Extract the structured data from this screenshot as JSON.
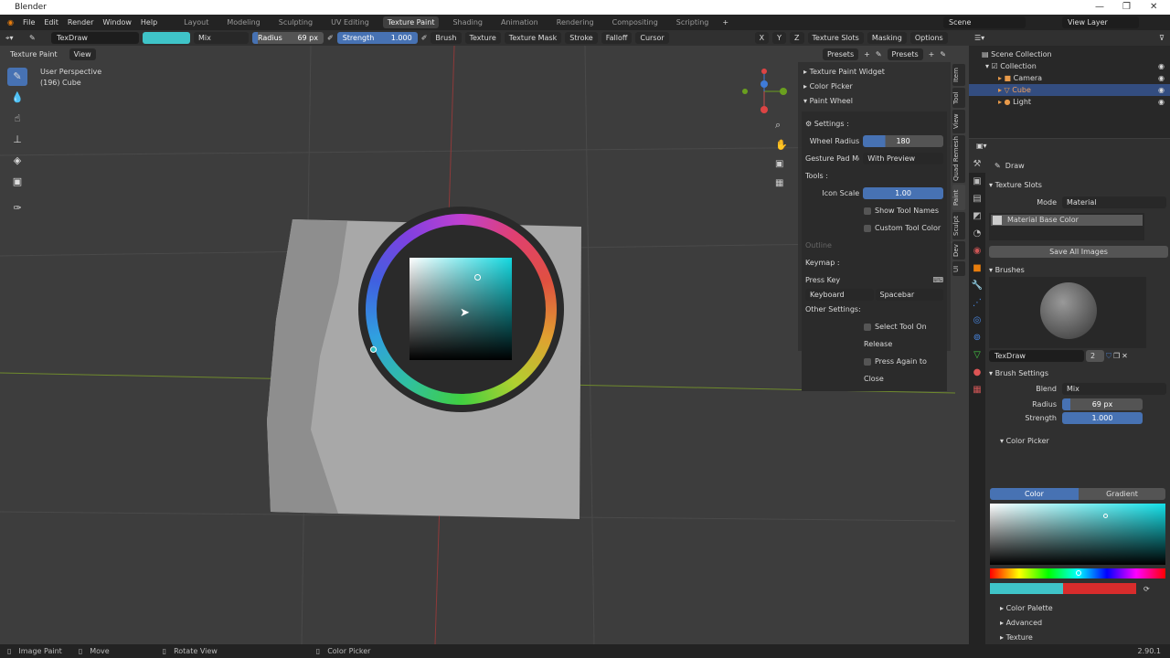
{
  "window": {
    "title": "Blender",
    "minimize": "—",
    "maximize": "❐",
    "close": "✕"
  },
  "menu": {
    "items": [
      "File",
      "Edit",
      "Render",
      "Window",
      "Help"
    ],
    "workspaces": [
      "Layout",
      "Modeling",
      "Sculpting",
      "UV Editing",
      "Texture Paint",
      "Shading",
      "Animation",
      "Rendering",
      "Compositing",
      "Scripting"
    ],
    "active_workspace": "Texture Paint",
    "add": "+",
    "scene": "Scene",
    "view_layer": "View Layer"
  },
  "tool_header": {
    "brush_name": "TexDraw",
    "color": "#3fc4c8",
    "blend": "Mix",
    "radius_label": "Radius",
    "radius_value": "69 px",
    "strength_label": "Strength",
    "strength_value": "1.000",
    "menus": [
      "Brush",
      "Texture",
      "Texture Mask",
      "Stroke",
      "Falloff",
      "Cursor"
    ],
    "axes": [
      "X",
      "Y",
      "Z"
    ],
    "right_menus": [
      "Texture Slots",
      "Masking",
      "Options"
    ]
  },
  "viewport_header": {
    "mode": "Texture Paint",
    "view": "View",
    "presets1": "Presets",
    "presets2": "Presets"
  },
  "viewport": {
    "perspective": "User Perspective",
    "object": "(196) Cube"
  },
  "npanel": {
    "panels": [
      "Texture Paint Widget",
      "Color Picker",
      "Paint Wheel"
    ],
    "settings_label": "Settings :",
    "wheel_radius_label": "Wheel Radius",
    "wheel_radius_value": "180",
    "wheel_radius_fraction": 0.28,
    "gesture_label": "Gesture Pad Mo...",
    "gesture_value": "With Preview",
    "tools_label": "Tools :",
    "icon_scale_label": "Icon Scale",
    "icon_scale_value": "1.00",
    "show_tool_names": "Show Tool Names",
    "custom_tool_color": "Custom Tool Color",
    "outline": "Outline",
    "keymap_label": "Keymap :",
    "press_key": "Press Key",
    "keyboard": "Keyboard",
    "spacebar": "Spacebar",
    "other_label": "Other Settings:",
    "select_on_release": "Select Tool On Release",
    "press_again": "Press Again to Close",
    "tabs": [
      "Item",
      "Tool",
      "View",
      "Quad Remesh",
      "Paint",
      "Sculpt",
      "Dev",
      "UI"
    ]
  },
  "outliner": {
    "root": "Scene Collection",
    "collection": "Collection",
    "items": [
      "Camera",
      "Cube",
      "Light"
    ],
    "selected": "Cube"
  },
  "properties": {
    "tool": "Draw",
    "texture_slots": "Texture Slots",
    "mode_label": "Mode",
    "mode_value": "Material",
    "slot": "Material Base Color",
    "save_all": "Save All Images",
    "brushes": "Brushes",
    "brush_name": "TexDraw",
    "brush_users": "2",
    "brush_settings": "Brush Settings",
    "blend_label": "Blend",
    "blend_value": "Mix",
    "radius_label": "Radius",
    "radius_value": "69 px",
    "strength_label": "Strength",
    "strength_value": "1.000",
    "color_picker": "Color Picker",
    "tab_color": "Color",
    "tab_gradient": "Gradient",
    "primary_color": "#3fc4c8",
    "secondary_color": "#d82c2c",
    "color_palette": "Color Palette",
    "advanced": "Advanced",
    "texture": "Texture"
  },
  "status": {
    "items": [
      "Image Paint",
      "Move",
      "Rotate View",
      "Color Picker"
    ],
    "version": "2.90.1"
  }
}
